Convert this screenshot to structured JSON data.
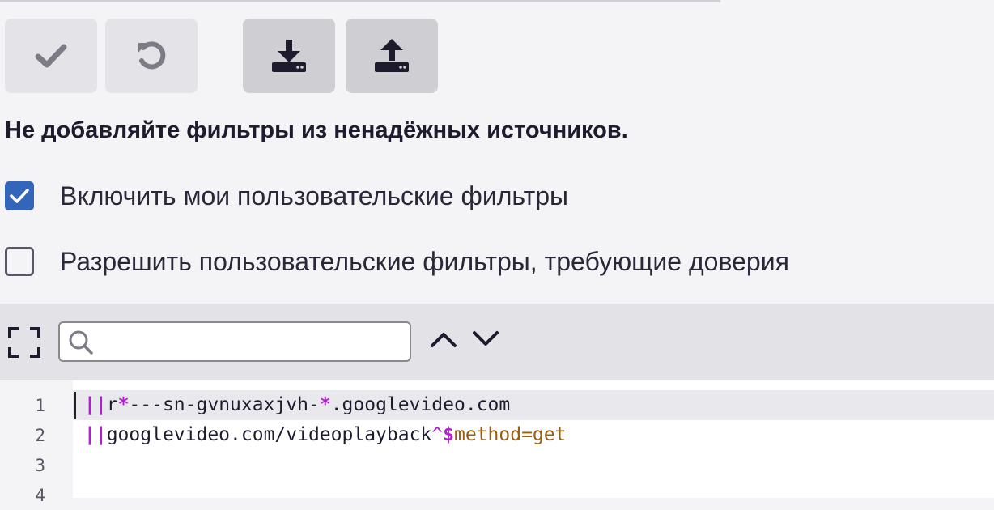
{
  "toolbar": {
    "apply": {
      "icon": "checkmark-icon",
      "enabled": false
    },
    "revert": {
      "icon": "undo-icon",
      "enabled": false
    },
    "import": {
      "icon": "download-icon",
      "enabled": true
    },
    "export": {
      "icon": "upload-icon",
      "enabled": true
    }
  },
  "warning": "Не добавляйте фильтры из ненадёжных источников.",
  "options": {
    "enable_filters": {
      "label": "Включить мои пользовательские фильтры",
      "checked": true
    },
    "allow_trusted": {
      "label": "Разрешить пользовательские фильтры, требующие доверия",
      "checked": false
    }
  },
  "editor": {
    "search": {
      "placeholder": "",
      "value": ""
    },
    "line_numbers": [
      "1",
      "2",
      "3",
      "4"
    ],
    "lines": [
      {
        "anchor": "||",
        "p1": "r",
        "w1": "*",
        "p2": "---sn-gvnuxaxjvh-",
        "w2": "*",
        "p3": ".googlevideo.com"
      },
      {
        "anchor": "||",
        "p1": "googlevideo.com/videoplayback",
        "sep": "^",
        "dollar": "$",
        "opt": "method=get"
      }
    ]
  },
  "colors": {
    "checkbox_checked": "#3366bb",
    "filter_anchor": "#b01fcf",
    "filter_option": "#9a5c0f"
  }
}
